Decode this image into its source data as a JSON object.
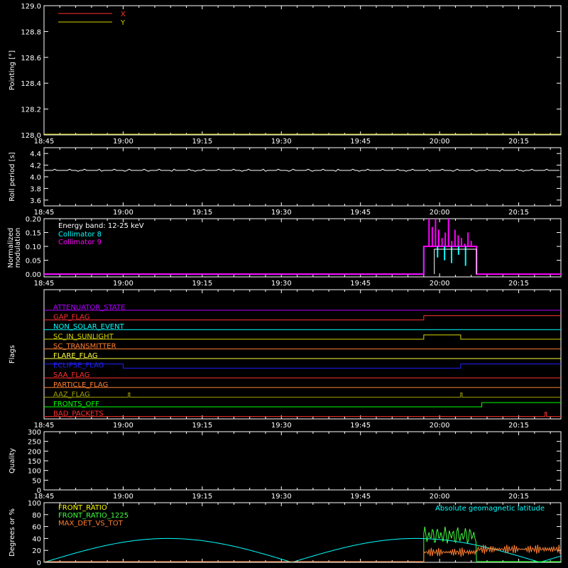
{
  "colors": {
    "background": "#000000",
    "axis": "#ffffff",
    "red": "#ff3030",
    "yellow": "#d4d400",
    "white": "#ffffff",
    "cyan": "#00ffff",
    "magenta": "#ff00ff",
    "purple": "#b000ff",
    "orange": "#ff7f30",
    "blue": "#2020ff",
    "green": "#00ff00",
    "olive": "#a0a000",
    "light_green": "#40ff40"
  },
  "time_ticks": [
    "18:45",
    "19:00",
    "19:15",
    "19:30",
    "19:45",
    "20:00",
    "20:15"
  ],
  "time_range": [
    "18:45",
    "20:23"
  ],
  "chart_data": [
    {
      "id": "pointing",
      "type": "line",
      "ylabel": "Pointing [°]",
      "ylim": [
        128.0,
        129.0
      ],
      "yticks": [
        "128.0",
        "128.2",
        "128.4",
        "128.6",
        "128.8",
        "129.0"
      ],
      "legend": "top-left",
      "series": [
        {
          "name": "X",
          "color": "#ff3030",
          "points": []
        },
        {
          "name": "Y",
          "color": "#d4d400",
          "points": []
        }
      ]
    },
    {
      "id": "roll",
      "type": "line",
      "ylabel": "Roll period [s]",
      "ylim": [
        3.5,
        4.5
      ],
      "yticks": [
        "3.6",
        "3.8",
        "4.0",
        "4.2",
        "4.4"
      ],
      "series": [
        {
          "color": "#ffffff",
          "points": [
            [
              "18:45",
              4.11
            ],
            [
              "19:00",
              4.11
            ],
            [
              "19:15",
              4.11
            ],
            [
              "19:30",
              4.12
            ],
            [
              "19:31",
              4.11
            ],
            [
              "19:45",
              4.11
            ],
            [
              "20:00",
              4.11
            ],
            [
              "20:15",
              4.11
            ],
            [
              "20:23",
              4.11
            ]
          ]
        }
      ]
    },
    {
      "id": "modulation",
      "type": "line",
      "ylabel": [
        "Normalized",
        "modulation"
      ],
      "ylim": [
        -0.01,
        0.2
      ],
      "yticks": [
        "0.00",
        "0.05",
        "0.10",
        "0.15",
        "0.20"
      ],
      "annotations": [
        "Energy band: 12-25 keV"
      ],
      "legend": "top-left",
      "series": [
        {
          "name": "Collimator 8",
          "color": "#00ffff",
          "points": [
            [
              "18:45",
              0
            ],
            [
              "19:57",
              0
            ],
            [
              "19:57",
              0.1
            ],
            [
              "20:07",
              0.1
            ],
            [
              "20:07",
              0
            ]
          ]
        },
        {
          "name": "Collimator 9",
          "color": "#ff00ff",
          "points": [
            [
              "18:45",
              0
            ],
            [
              "19:57",
              0
            ],
            [
              "19:57",
              0.1
            ],
            [
              "20:07",
              0.1
            ],
            [
              "20:07",
              0
            ],
            [
              "20:23",
              0
            ]
          ]
        }
      ],
      "spikes": {
        "color": "#ff00ff",
        "range": [
          "19:58",
          "20:06"
        ],
        "max": 0.2
      }
    },
    {
      "id": "flags",
      "type": "line",
      "ylabel": "Flags",
      "flags": [
        {
          "name": "ATTENUATOR_STATE",
          "color": "#b000ff",
          "steps": []
        },
        {
          "name": "GAP_FLAG",
          "color": "#ff3030",
          "steps": [
            [
              "19:57",
              1
            ]
          ]
        },
        {
          "name": "NON_SOLAR_EVENT",
          "color": "#00ffff",
          "steps": []
        },
        {
          "name": "SC_IN_SUNLIGHT",
          "color": "#d4d400",
          "steps": [
            [
              "19:57",
              1
            ],
            [
              "20:04",
              0
            ]
          ]
        },
        {
          "name": "SC_TRANSMITTER",
          "color": "#ff7f30",
          "steps": []
        },
        {
          "name": "FLARE_FLAG",
          "color": "#ffff40",
          "steps": []
        },
        {
          "name": "ECLIPSE_FLAG",
          "color": "#2020ff",
          "steps": [
            [
              "19:00",
              1
            ],
            [
              "20:04",
              0
            ]
          ]
        },
        {
          "name": "SAA_FLAG",
          "color": "#ff3030",
          "steps": []
        },
        {
          "name": "PARTICLE_FLAG",
          "color": "#ff7f30",
          "steps": []
        },
        {
          "name": "AAZ_FLAG",
          "color": "#a0a000",
          "pulses": [
            "19:01",
            "20:04"
          ]
        },
        {
          "name": "FRONTS_OFF",
          "color": "#00ff00",
          "steps": [
            [
              "20:08",
              1
            ]
          ]
        },
        {
          "name": "BAD_PACKETS",
          "color": "#ff3030",
          "pulses": [
            "20:20"
          ]
        }
      ]
    },
    {
      "id": "quality",
      "type": "line",
      "ylabel": "Quality",
      "ylim": [
        0,
        300
      ],
      "yticks": [
        "0",
        "50",
        "100",
        "150",
        "200",
        "250",
        "300"
      ],
      "series": []
    },
    {
      "id": "geo",
      "type": "line",
      "ylabel": "Degrees or %",
      "ylim": [
        0,
        100
      ],
      "yticks": [
        "0",
        "20",
        "40",
        "60",
        "80",
        "100"
      ],
      "legend": "top-left",
      "annotations": [
        "Absolute geomagnetic latitude"
      ],
      "series": [
        {
          "name": "FRONT_RATIO",
          "color": "#ffff00",
          "points": []
        },
        {
          "name": "FRONT_RATIO_1225",
          "color": "#40ff40",
          "points": [
            [
              "19:57",
              50
            ],
            [
              "20:07",
              50
            ]
          ]
        },
        {
          "name": "MAX_DET_VS_TOT",
          "color": "#ff7f30",
          "points": [
            [
              "19:57",
              20
            ],
            [
              "20:23",
              20
            ]
          ]
        },
        {
          "name": "Absolute geomagnetic latitude",
          "color": "#00ffff",
          "points": [
            [
              "18:45",
              0
            ],
            [
              "19:06",
              40
            ],
            [
              "19:32",
              0
            ],
            [
              "19:57",
              40
            ],
            [
              "20:19",
              0
            ],
            [
              "20:23",
              5
            ]
          ]
        }
      ]
    }
  ]
}
